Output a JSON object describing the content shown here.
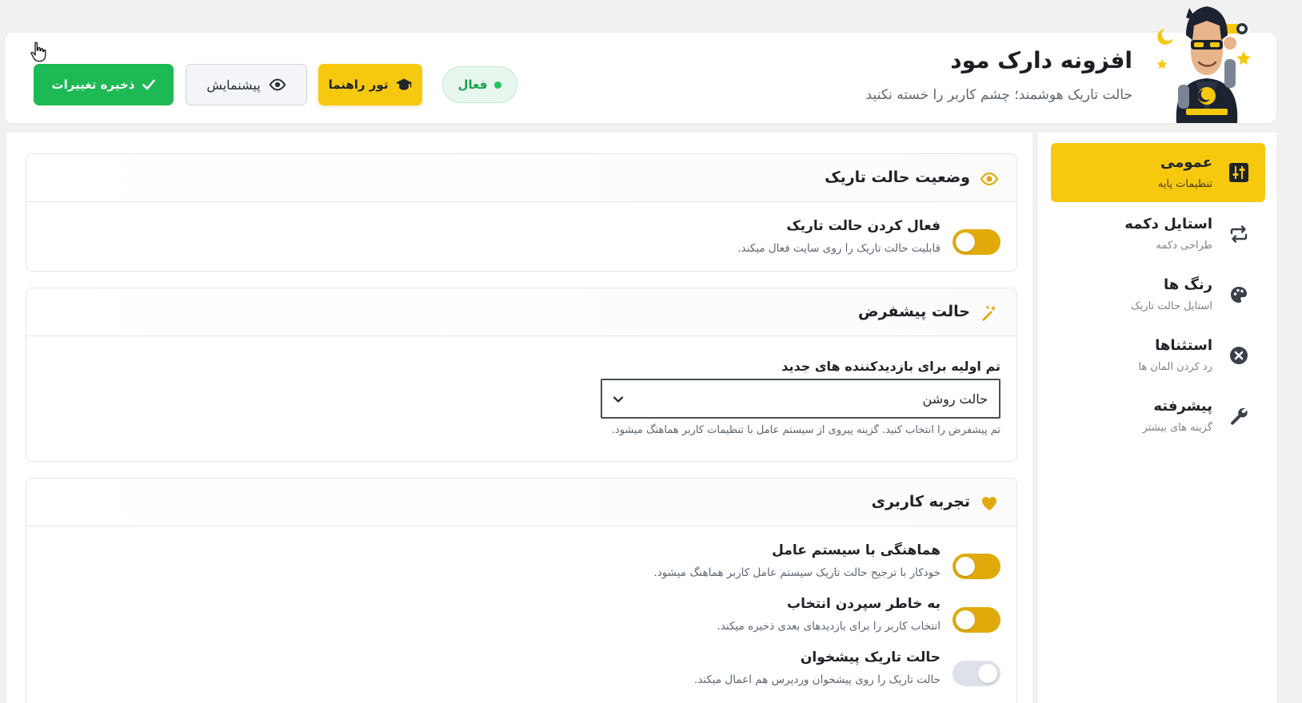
{
  "header": {
    "title": "افزونه دارک مود",
    "subtitle": "حالت تاریک هوشمند؛ چشم کاربر را خسته نکنید",
    "status_label": "فعال",
    "tour_button": "تور راهنما",
    "preview_button": "پیشنمایش",
    "save_button": "ذخیره تغییرات"
  },
  "sidebar": {
    "items": [
      {
        "label": "عمومی",
        "sub": "تنظیمات پایه",
        "icon": "sliders-icon",
        "active": true
      },
      {
        "label": "استایل دکمه",
        "sub": "طراحی دکمه",
        "icon": "repeat-icon",
        "active": false
      },
      {
        "label": "رنگ ها",
        "sub": "استایل حالت تاریک",
        "icon": "palette-icon",
        "active": false
      },
      {
        "label": "استثناها",
        "sub": "رد کردن المان ها",
        "icon": "close-circle-icon",
        "active": false
      },
      {
        "label": "پیشرفته",
        "sub": "گزینه های بیشتر",
        "icon": "wrench-icon",
        "active": false
      }
    ]
  },
  "cards": {
    "status": {
      "title": "وضعیت حالت تاریک",
      "setting": {
        "label": "فعال کردن حالت تاریک",
        "desc": "قابلیت حالت تاریک را روی سایت فعال میکند.",
        "enabled": true
      }
    },
    "default": {
      "title": "حالت پیشفرض",
      "field_label": "تم اولیه برای بازدیدکننده های جدید",
      "select_value": "حالت روشن",
      "field_help": "تم پیشفرض را انتخاب کنید. گزینه پیروی از سیستم عامل با تنظیمات کاربر هماهنگ میشود."
    },
    "ux": {
      "title": "تجربه کاربری",
      "settings": [
        {
          "label": "هماهنگی با سیستم عامل",
          "desc": "خودکار با ترجیح حالت تاریک سیستم عامل کاربر هماهنگ میشود.",
          "enabled": true
        },
        {
          "label": "به خاطر سپردن انتخاب",
          "desc": "انتخاب کاربر را برای بازدیدهای بعدی ذخیره میکند.",
          "enabled": true
        },
        {
          "label": "حالت تاریک پیشخوان",
          "desc": "حالت تاریک را روی پیشخوان وردپرس هم اعمال میکند.",
          "enabled": false
        }
      ]
    }
  },
  "colors": {
    "accent": "#f6c90e",
    "toggle_on": "#e1aa0b",
    "save_green": "#1db954",
    "status_green": "#16a34a"
  }
}
